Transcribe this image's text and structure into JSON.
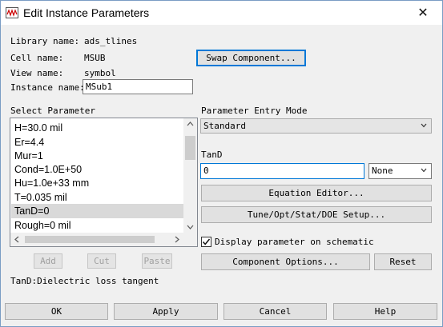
{
  "window": {
    "title": "Edit Instance Parameters",
    "close_glyph": "✕"
  },
  "info": {
    "library_label": "Library name:",
    "library_value": "ads_tlines",
    "cell_label": "Cell name:",
    "cell_value": "MSUB",
    "view_label": "View name:",
    "view_value": "symbol",
    "instance_label": "Instance name:",
    "instance_value": "MSub1"
  },
  "swap_button": "Swap Component...",
  "select_parameter": {
    "heading": "Select Parameter",
    "items": [
      "H=30.0 mil",
      "Er=4.4",
      "Mur=1",
      "Cond=1.0E+50",
      "Hu=1.0e+33 mm",
      "T=0.035 mil",
      "TanD=0",
      "Rough=0 mil"
    ],
    "selected_index": 6
  },
  "list_buttons": {
    "add": "Add",
    "cut": "Cut",
    "paste": "Paste"
  },
  "entry_mode": {
    "heading": "Parameter Entry Mode",
    "value": "Standard"
  },
  "param": {
    "name": "TanD",
    "value": "0",
    "unit": "None"
  },
  "buttons": {
    "equation_editor": "Equation Editor...",
    "tune_setup": "Tune/Opt/Stat/DOE Setup...",
    "component_options": "Component Options...",
    "reset": "Reset"
  },
  "display_checkbox": {
    "label": "Display parameter on schematic",
    "checked": true
  },
  "description": "TanD:Dielectric loss tangent",
  "footer": {
    "ok": "OK",
    "apply": "Apply",
    "cancel": "Cancel",
    "help": "Help"
  },
  "colors": {
    "focus": "#0078d7",
    "selection": "#d9d9d9",
    "button_face": "#e1e1e1",
    "window_bg": "#f0f0f0"
  }
}
